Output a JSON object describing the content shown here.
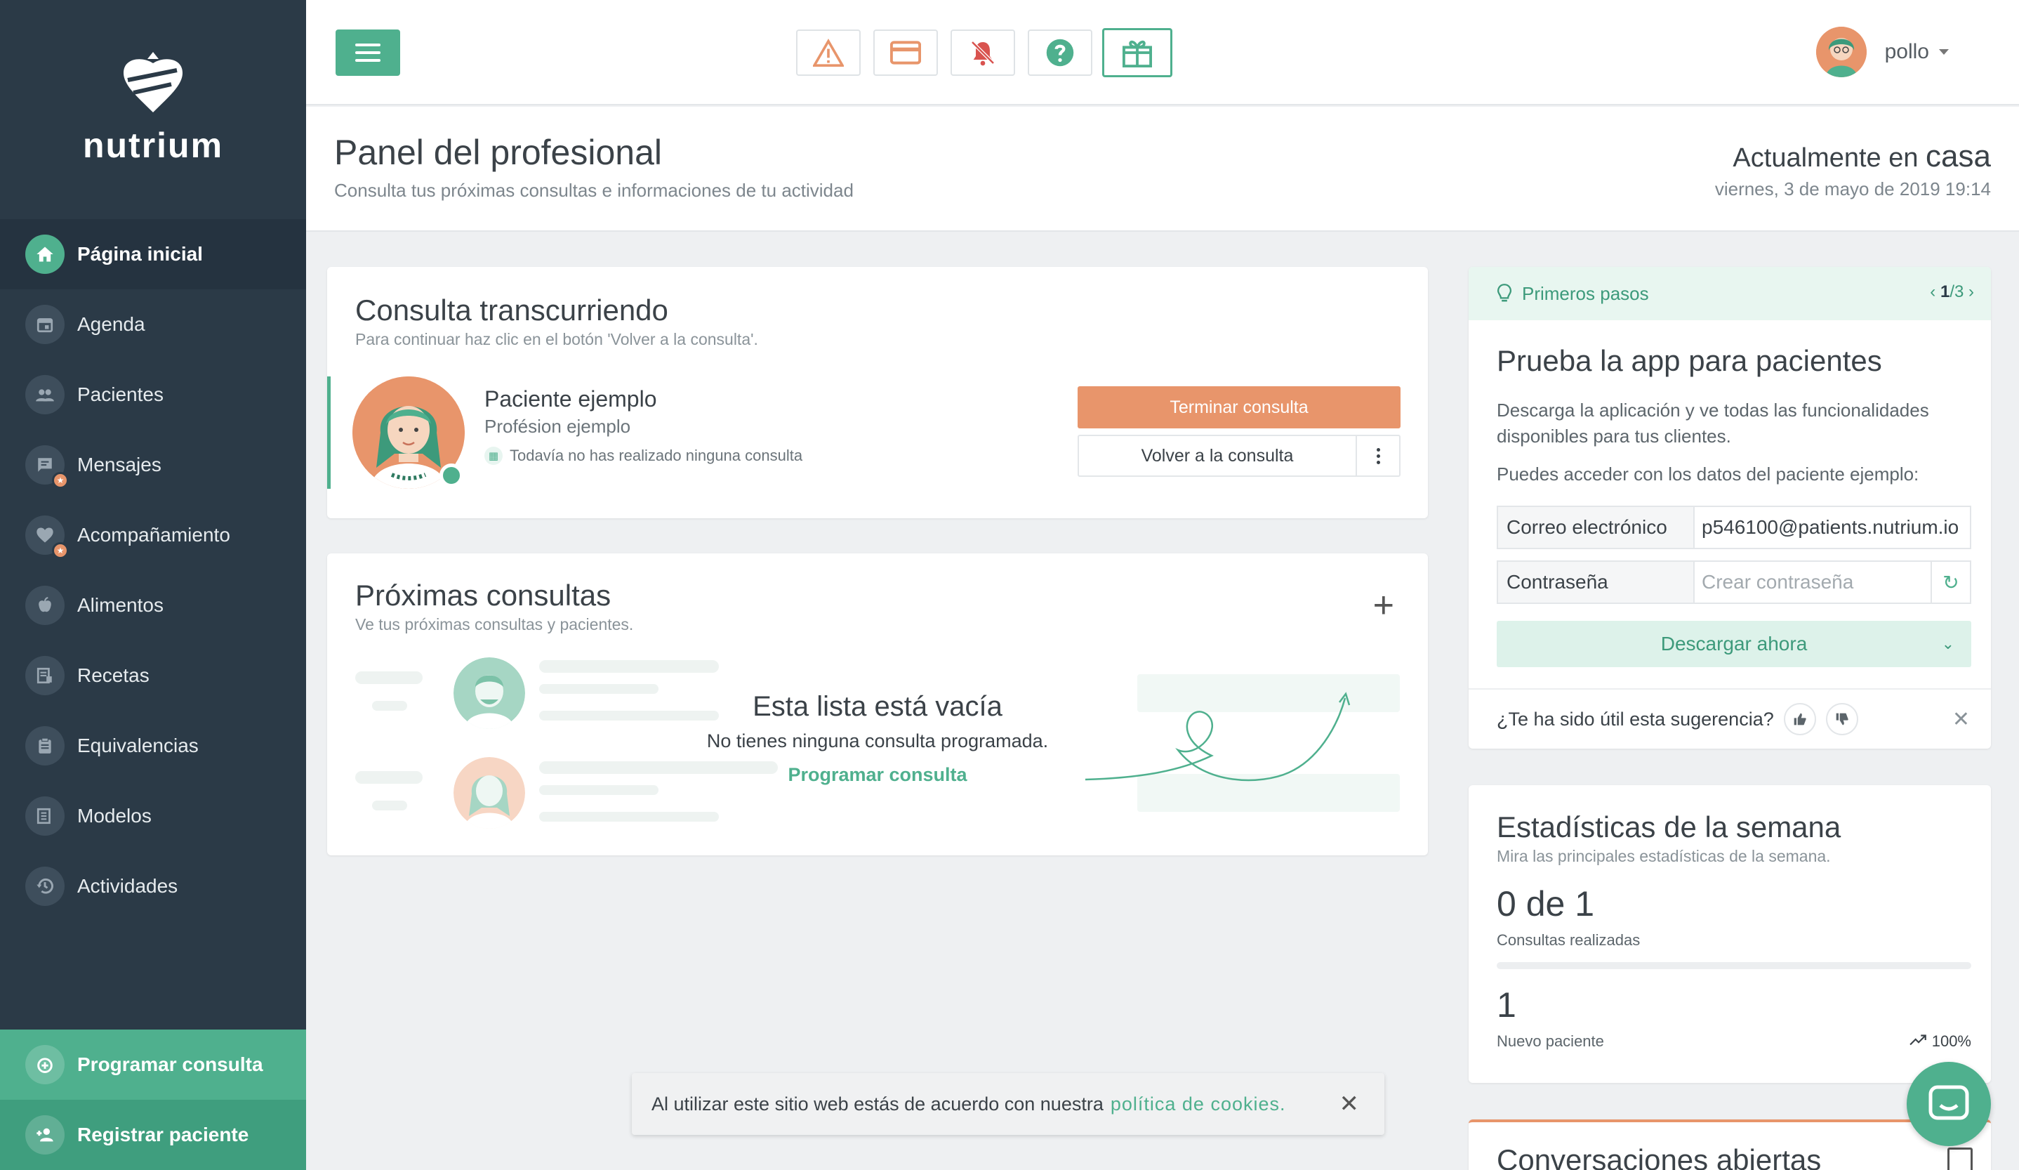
{
  "sidebar": {
    "brand": "nutrium",
    "items": [
      {
        "label": "Página inicial",
        "icon": "home-icon",
        "active": true
      },
      {
        "label": "Agenda",
        "icon": "calendar-icon"
      },
      {
        "label": "Pacientes",
        "icon": "people-icon"
      },
      {
        "label": "Mensajes",
        "icon": "message-icon",
        "badge": true
      },
      {
        "label": "Acompañamiento",
        "icon": "heart-icon",
        "badge": true
      },
      {
        "label": "Alimentos",
        "icon": "apple-icon"
      },
      {
        "label": "Recetas",
        "icon": "recipe-icon"
      },
      {
        "label": "Equivalencias",
        "icon": "clipboard-icon"
      },
      {
        "label": "Modelos",
        "icon": "document-icon"
      },
      {
        "label": "Actividades",
        "icon": "history-icon"
      }
    ],
    "actions": [
      {
        "label": "Programar consulta",
        "icon": "add-alarm-icon"
      },
      {
        "label": "Registrar paciente",
        "icon": "add-person-icon"
      }
    ]
  },
  "topbar": {
    "menu_icon": "hamburger-icon",
    "tools": [
      "warning-icon",
      "credit-card-icon",
      "bell-off-icon",
      "help-icon",
      "gift-icon"
    ],
    "user": "pollo"
  },
  "header": {
    "title": "Panel del profesional",
    "subtitle": "Consulta tus próximas consultas e informaciones de tu actividad",
    "location_prefix": "Actualmente en",
    "location": "casa",
    "datetime": "viernes, 3 de mayo de 2019 19:14"
  },
  "current": {
    "title": "Consulta transcurriendo",
    "subtitle": "Para continuar haz clic en el botón 'Volver a la consulta'.",
    "patient_name": "Paciente ejemplo",
    "patient_profession": "Profésion ejemplo",
    "note": "Todavía no has realizado ninguna consulta",
    "end_label": "Terminar consulta",
    "back_label": "Volver a la consulta"
  },
  "upcoming": {
    "title": "Próximas consultas",
    "subtitle": "Ve tus próximas consultas y pacientes.",
    "empty_title": "Esta lista está vacía",
    "empty_sub": "No tienes ninguna consulta programada.",
    "empty_link": "Programar consulta"
  },
  "tips": {
    "header": "Primeros pasos",
    "pager_current": "1",
    "pager_total": "/3",
    "title": "Prueba la app para pacientes",
    "desc": "Descarga la aplicación y ve todas las funcionalidades disponibles para tus clientes.",
    "access": "Puedes acceder con los datos del paciente ejemplo:",
    "email_label": "Correo electrónico",
    "email_value": "p546100@patients.nutrium.io",
    "password_label": "Contraseña",
    "password_placeholder": "Crear contraseña",
    "download_label": "Descargar ahora",
    "feedback": "¿Te ha sido útil esta sugerencia?"
  },
  "stats": {
    "title": "Estadísticas de la semana",
    "subtitle": "Mira las principales estadísticas de la semana.",
    "consults_value": "0 de 1",
    "consults_label": "Consultas realizadas",
    "consults_progress": 0,
    "patients_value": "1",
    "patients_label": "Nuevo paciente",
    "patients_trend": "100%"
  },
  "conversations": {
    "title": "Conversaciones abiertas"
  },
  "cookie": {
    "text": "Al utilizar este sitio web estás de acuerdo con nuestra",
    "link": "política de cookies."
  },
  "colors": {
    "accent": "#4fb08e",
    "sidebar": "#2b3a47",
    "warning": "#e8956b"
  }
}
